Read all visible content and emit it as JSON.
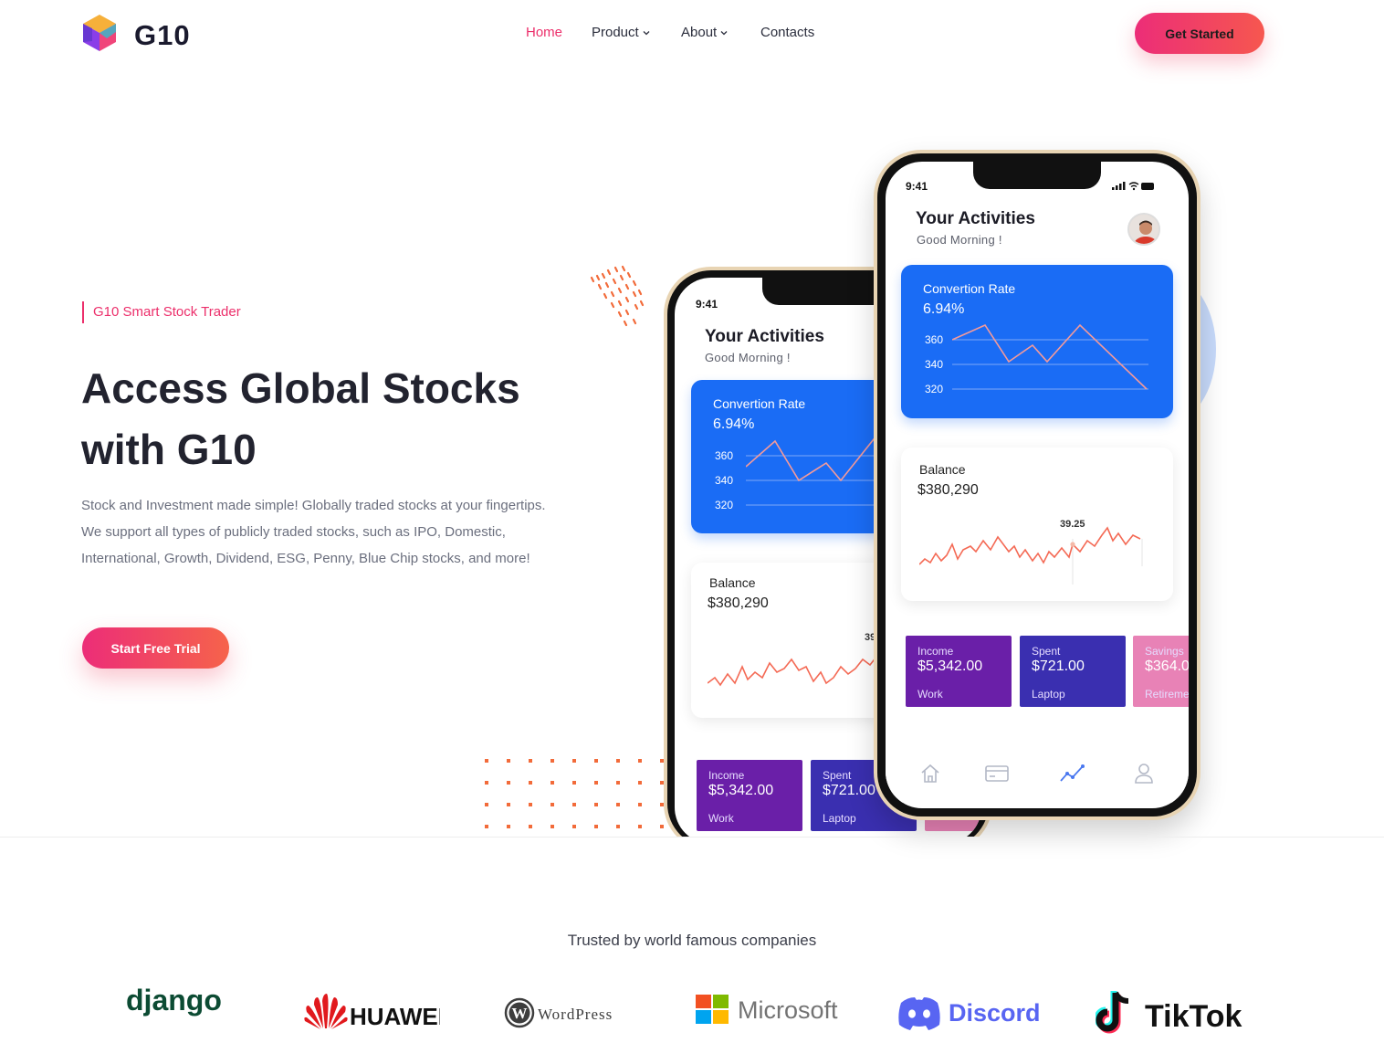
{
  "nav": {
    "logo_text": "G10",
    "menu": [
      {
        "label": "Home",
        "active": true
      },
      {
        "label": "Product",
        "dropdown": true
      },
      {
        "label": "About",
        "dropdown": true
      },
      {
        "label": "Contacts"
      }
    ],
    "cta_label": "Get Started"
  },
  "hero": {
    "eyebrow": "G10 Smart Stock Trader",
    "title_line1": "Access Global Stocks",
    "title_line2": "with G10",
    "description": "Stock and Investment made simple! Globally traded stocks at your fingertips. We support all types of publicly traded stocks, such as IPO, Domestic, International, Growth, Dividend, ESG, Penny, Blue Chip stocks, and more!",
    "cta_label": "Start Free Trial"
  },
  "phone": {
    "time": "9:41",
    "title": "Your Activities",
    "greeting": "Good Morning !",
    "conversion_card": {
      "title": "Convertion Rate",
      "value": "6.94%",
      "ticks": [
        "360",
        "340",
        "320"
      ]
    },
    "balance_card": {
      "title": "Balance",
      "value": "$380,290",
      "marker": "39.25"
    },
    "mini_cards": [
      {
        "label": "Income",
        "value": "$5,342.00",
        "sub": "Work"
      },
      {
        "label": "Spent",
        "value": "$721.00",
        "sub": "Laptop"
      },
      {
        "label": "Savings",
        "value": "$364.0",
        "sub": "Retireme"
      }
    ],
    "tabs": [
      "home-icon",
      "card-icon",
      "chart-icon",
      "user-icon"
    ]
  },
  "trusted": {
    "heading": "Trusted by world famous companies",
    "brands": [
      "django",
      "HUAWEI",
      "WordPress",
      "Microsoft",
      "Discord",
      "TikTok"
    ]
  },
  "colors": {
    "accent": "#ec2f6b",
    "blue_card": "#1a6cf5",
    "income": "#6a1fa8",
    "spent": "#3a2fb0",
    "savings": "#e882b6"
  }
}
